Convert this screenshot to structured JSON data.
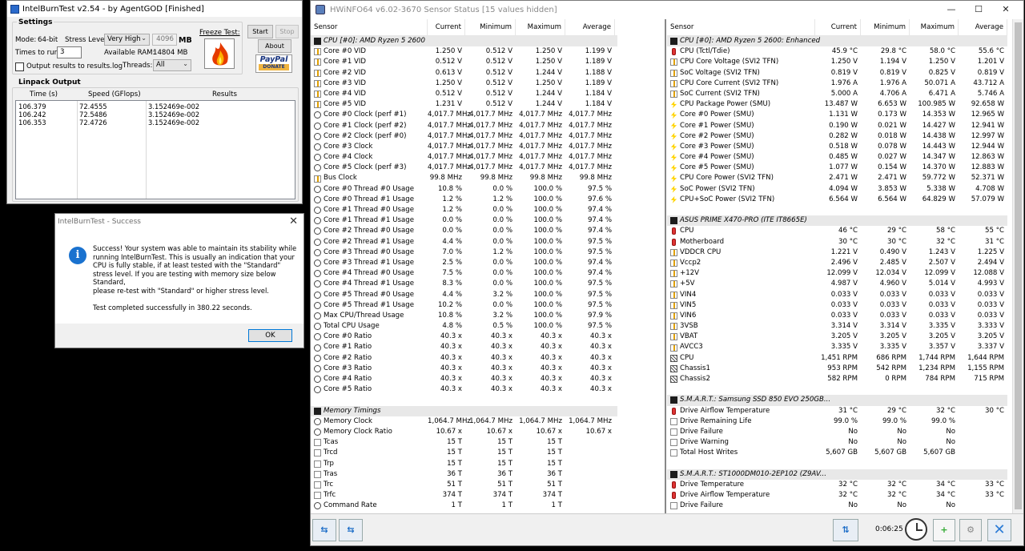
{
  "ibt": {
    "title": "IntelBurnTest v2.54 - by AgentGOD [Finished]",
    "settings_legend": "Settings",
    "mode_label": "Mode:",
    "mode_value": "64-bit",
    "stress_label": "Stress Level:",
    "stress_value": "Very High",
    "stress_mb": "4096",
    "mb_label": "MB",
    "times_label": "Times to run:",
    "times_value": "3",
    "ram_label": "Available RAM:",
    "ram_value": "14804 MB",
    "output_label": "Output results to results.log",
    "threads_label": "Threads:",
    "threads_value": "All",
    "freeze_label": "Freeze Test:",
    "start_label": "Start",
    "stop_label": "Stop",
    "about_label": "About",
    "paypal_label": "PayPal",
    "donate_label": "DONATE",
    "linpack_legend": "Linpack Output",
    "columns": [
      "Time (s)",
      "Speed (GFlops)",
      "Results"
    ],
    "rows": [
      [
        "106.379",
        "72.4555",
        "3.152469e-002"
      ],
      [
        "106.242",
        "72.5486",
        "3.152469e-002"
      ],
      [
        "106.353",
        "72.4726",
        "3.152469e-002"
      ]
    ]
  },
  "msg": {
    "title": "IntelBurnTest - Success",
    "text": "Success! Your system was able to maintain its stability while running IntelBurnTest. This is usually an indication that your CPU is fully stable, if at least tested with the \"Standard\" stress level. If you are testing with memory size below Standard,\nplease re-test with \"Standard\" or higher stress level.\n\nTest completed successfully in 380.22 seconds.",
    "ok": "OK"
  },
  "hw": {
    "title": "HWiNFO64 v6.02-3670 Sensor Status [15 values hidden]",
    "minimize": "—",
    "maximize": "☐",
    "close": "✕",
    "columns": [
      "Sensor",
      "Current",
      "Minimum",
      "Maximum",
      "Average"
    ],
    "timer": "0:06:25",
    "left": [
      {
        "g": "CPU [#0]: AMD Ryzen 5 2600"
      },
      {
        "n": "Core #0 VID",
        "i": "volt",
        "c": "1.250 V",
        "mn": "0.512 V",
        "mx": "1.250 V",
        "a": "1.199 V"
      },
      {
        "n": "Core #1 VID",
        "i": "volt",
        "c": "0.512 V",
        "mn": "0.512 V",
        "mx": "1.250 V",
        "a": "1.189 V"
      },
      {
        "n": "Core #2 VID",
        "i": "volt",
        "c": "0.613 V",
        "mn": "0.512 V",
        "mx": "1.244 V",
        "a": "1.188 V"
      },
      {
        "n": "Core #3 VID",
        "i": "volt",
        "c": "1.250 V",
        "mn": "0.512 V",
        "mx": "1.250 V",
        "a": "1.189 V"
      },
      {
        "n": "Core #4 VID",
        "i": "volt",
        "c": "0.512 V",
        "mn": "0.512 V",
        "mx": "1.244 V",
        "a": "1.184 V"
      },
      {
        "n": "Core #5 VID",
        "i": "volt",
        "c": "1.231 V",
        "mn": "0.512 V",
        "mx": "1.244 V",
        "a": "1.184 V"
      },
      {
        "n": "Core #0 Clock (perf #1)",
        "i": "clock",
        "c": "4,017.7 MHz",
        "mn": "4,017.7 MHz",
        "mx": "4,017.7 MHz",
        "a": "4,017.7 MHz"
      },
      {
        "n": "Core #1 Clock (perf #2)",
        "i": "clock",
        "c": "4,017.7 MHz",
        "mn": "4,017.7 MHz",
        "mx": "4,017.7 MHz",
        "a": "4,017.7 MHz"
      },
      {
        "n": "Core #2 Clock (perf #0)",
        "i": "clock",
        "c": "4,017.7 MHz",
        "mn": "4,017.7 MHz",
        "mx": "4,017.7 MHz",
        "a": "4,017.7 MHz"
      },
      {
        "n": "Core #3 Clock",
        "i": "clock",
        "c": "4,017.7 MHz",
        "mn": "4,017.7 MHz",
        "mx": "4,017.7 MHz",
        "a": "4,017.7 MHz"
      },
      {
        "n": "Core #4 Clock",
        "i": "clock",
        "c": "4,017.7 MHz",
        "mn": "4,017.7 MHz",
        "mx": "4,017.7 MHz",
        "a": "4,017.7 MHz"
      },
      {
        "n": "Core #5 Clock (perf #3)",
        "i": "clock",
        "c": "4,017.7 MHz",
        "mn": "4,017.7 MHz",
        "mx": "4,017.7 MHz",
        "a": "4,017.7 MHz"
      },
      {
        "n": "Bus Clock",
        "i": "volt",
        "c": "99.8 MHz",
        "mn": "99.8 MHz",
        "mx": "99.8 MHz",
        "a": "99.8 MHz"
      },
      {
        "n": "Core #0 Thread #0 Usage",
        "i": "clock",
        "c": "10.8 %",
        "mn": "0.0 %",
        "mx": "100.0 %",
        "a": "97.5 %"
      },
      {
        "n": "Core #0 Thread #1 Usage",
        "i": "clock",
        "c": "1.2 %",
        "mn": "1.2 %",
        "mx": "100.0 %",
        "a": "97.6 %"
      },
      {
        "n": "Core #1 Thread #0 Usage",
        "i": "clock",
        "c": "1.2 %",
        "mn": "0.0 %",
        "mx": "100.0 %",
        "a": "97.4 %"
      },
      {
        "n": "Core #1 Thread #1 Usage",
        "i": "clock",
        "c": "0.0 %",
        "mn": "0.0 %",
        "mx": "100.0 %",
        "a": "97.4 %"
      },
      {
        "n": "Core #2 Thread #0 Usage",
        "i": "clock",
        "c": "0.0 %",
        "mn": "0.0 %",
        "mx": "100.0 %",
        "a": "97.4 %"
      },
      {
        "n": "Core #2 Thread #1 Usage",
        "i": "clock",
        "c": "4.4 %",
        "mn": "0.0 %",
        "mx": "100.0 %",
        "a": "97.5 %"
      },
      {
        "n": "Core #3 Thread #0 Usage",
        "i": "clock",
        "c": "7.0 %",
        "mn": "1.2 %",
        "mx": "100.0 %",
        "a": "97.5 %"
      },
      {
        "n": "Core #3 Thread #1 Usage",
        "i": "clock",
        "c": "2.5 %",
        "mn": "0.0 %",
        "mx": "100.0 %",
        "a": "97.4 %"
      },
      {
        "n": "Core #4 Thread #0 Usage",
        "i": "clock",
        "c": "7.5 %",
        "mn": "0.0 %",
        "mx": "100.0 %",
        "a": "97.4 %"
      },
      {
        "n": "Core #4 Thread #1 Usage",
        "i": "clock",
        "c": "8.3 %",
        "mn": "0.0 %",
        "mx": "100.0 %",
        "a": "97.5 %"
      },
      {
        "n": "Core #5 Thread #0 Usage",
        "i": "clock",
        "c": "4.4 %",
        "mn": "3.2 %",
        "mx": "100.0 %",
        "a": "97.5 %"
      },
      {
        "n": "Core #5 Thread #1 Usage",
        "i": "clock",
        "c": "10.2 %",
        "mn": "0.0 %",
        "mx": "100.0 %",
        "a": "97.5 %"
      },
      {
        "n": "Max CPU/Thread Usage",
        "i": "clock",
        "c": "10.8 %",
        "mn": "3.2 %",
        "mx": "100.0 %",
        "a": "97.9 %"
      },
      {
        "n": "Total CPU Usage",
        "i": "clock",
        "c": "4.8 %",
        "mn": "0.5 %",
        "mx": "100.0 %",
        "a": "97.5 %"
      },
      {
        "n": "Core #0 Ratio",
        "i": "clock",
        "c": "40.3 x",
        "mn": "40.3 x",
        "mx": "40.3 x",
        "a": "40.3 x"
      },
      {
        "n": "Core #1 Ratio",
        "i": "clock",
        "c": "40.3 x",
        "mn": "40.3 x",
        "mx": "40.3 x",
        "a": "40.3 x"
      },
      {
        "n": "Core #2 Ratio",
        "i": "clock",
        "c": "40.3 x",
        "mn": "40.3 x",
        "mx": "40.3 x",
        "a": "40.3 x"
      },
      {
        "n": "Core #3 Ratio",
        "i": "clock",
        "c": "40.3 x",
        "mn": "40.3 x",
        "mx": "40.3 x",
        "a": "40.3 x"
      },
      {
        "n": "Core #4 Ratio",
        "i": "clock",
        "c": "40.3 x",
        "mn": "40.3 x",
        "mx": "40.3 x",
        "a": "40.3 x"
      },
      {
        "n": "Core #5 Ratio",
        "i": "clock",
        "c": "40.3 x",
        "mn": "40.3 x",
        "mx": "40.3 x",
        "a": "40.3 x"
      },
      {
        "gap": true
      },
      {
        "g": "Memory Timings"
      },
      {
        "n": "Memory Clock",
        "i": "clock",
        "c": "1,064.7 MHz",
        "mn": "1,064.7 MHz",
        "mx": "1,064.7 MHz",
        "a": "1,064.7 MHz"
      },
      {
        "n": "Memory Clock Ratio",
        "i": "clock",
        "c": "10.67 x",
        "mn": "10.67 x",
        "mx": "10.67 x",
        "a": "10.67 x"
      },
      {
        "n": "Tcas",
        "i": "box",
        "c": "15 T",
        "mn": "15 T",
        "mx": "15 T",
        "a": ""
      },
      {
        "n": "Trcd",
        "i": "box",
        "c": "15 T",
        "mn": "15 T",
        "mx": "15 T",
        "a": ""
      },
      {
        "n": "Trp",
        "i": "box",
        "c": "15 T",
        "mn": "15 T",
        "mx": "15 T",
        "a": ""
      },
      {
        "n": "Tras",
        "i": "box",
        "c": "36 T",
        "mn": "36 T",
        "mx": "36 T",
        "a": ""
      },
      {
        "n": "Trc",
        "i": "box",
        "c": "51 T",
        "mn": "51 T",
        "mx": "51 T",
        "a": ""
      },
      {
        "n": "Trfc",
        "i": "box",
        "c": "374 T",
        "mn": "374 T",
        "mx": "374 T",
        "a": ""
      },
      {
        "n": "Command Rate",
        "i": "clock",
        "c": "1 T",
        "mn": "1 T",
        "mx": "1 T",
        "a": ""
      }
    ],
    "right": [
      {
        "g": "CPU [#0]: AMD Ryzen 5 2600: Enhanced"
      },
      {
        "n": "CPU (Tctl/Tdie)",
        "i": "temp",
        "c": "45.9 °C",
        "mn": "29.8 °C",
        "mx": "58.0 °C",
        "a": "55.6 °C"
      },
      {
        "n": "CPU Core Voltage (SVI2 TFN)",
        "i": "volt",
        "c": "1.250 V",
        "mn": "1.194 V",
        "mx": "1.250 V",
        "a": "1.201 V"
      },
      {
        "n": "SoC Voltage (SVI2 TFN)",
        "i": "volt",
        "c": "0.819 V",
        "mn": "0.819 V",
        "mx": "0.825 V",
        "a": "0.819 V"
      },
      {
        "n": "CPU Core Current (SVI2 TFN)",
        "i": "volt",
        "c": "1.976 A",
        "mn": "1.976 A",
        "mx": "50.071 A",
        "a": "43.712 A"
      },
      {
        "n": "SoC Current (SVI2 TFN)",
        "i": "volt",
        "c": "5.000 A",
        "mn": "4.706 A",
        "mx": "6.471 A",
        "a": "5.746 A"
      },
      {
        "n": "CPU Package Power (SMU)",
        "i": "bolt",
        "c": "13.487 W",
        "mn": "6.653 W",
        "mx": "100.985 W",
        "a": "92.658 W"
      },
      {
        "n": "Core #0 Power (SMU)",
        "i": "bolt",
        "c": "1.131 W",
        "mn": "0.173 W",
        "mx": "14.353 W",
        "a": "12.965 W"
      },
      {
        "n": "Core #1 Power (SMU)",
        "i": "bolt",
        "c": "0.190 W",
        "mn": "0.021 W",
        "mx": "14.427 W",
        "a": "12.941 W"
      },
      {
        "n": "Core #2 Power (SMU)",
        "i": "bolt",
        "c": "0.282 W",
        "mn": "0.018 W",
        "mx": "14.438 W",
        "a": "12.997 W"
      },
      {
        "n": "Core #3 Power (SMU)",
        "i": "bolt",
        "c": "0.518 W",
        "mn": "0.078 W",
        "mx": "14.443 W",
        "a": "12.944 W"
      },
      {
        "n": "Core #4 Power (SMU)",
        "i": "bolt",
        "c": "0.485 W",
        "mn": "0.027 W",
        "mx": "14.347 W",
        "a": "12.863 W"
      },
      {
        "n": "Core #5 Power (SMU)",
        "i": "bolt",
        "c": "1.077 W",
        "mn": "0.154 W",
        "mx": "14.370 W",
        "a": "12.883 W"
      },
      {
        "n": "CPU Core Power (SVI2 TFN)",
        "i": "bolt",
        "c": "2.471 W",
        "mn": "2.471 W",
        "mx": "59.772 W",
        "a": "52.371 W"
      },
      {
        "n": "SoC Power (SVI2 TFN)",
        "i": "bolt",
        "c": "4.094 W",
        "mn": "3.853 W",
        "mx": "5.338 W",
        "a": "4.708 W"
      },
      {
        "n": "CPU+SoC Power (SVI2 TFN)",
        "i": "bolt",
        "c": "6.564 W",
        "mn": "6.564 W",
        "mx": "64.829 W",
        "a": "57.079 W"
      },
      {
        "gap": true
      },
      {
        "g": "ASUS PRIME X470-PRO (ITE IT8665E)"
      },
      {
        "n": "CPU",
        "i": "temp",
        "c": "46 °C",
        "mn": "29 °C",
        "mx": "58 °C",
        "a": "55 °C"
      },
      {
        "n": "Motherboard",
        "i": "temp",
        "c": "30 °C",
        "mn": "30 °C",
        "mx": "32 °C",
        "a": "31 °C"
      },
      {
        "n": "VDDCR CPU",
        "i": "volt",
        "c": "1.221 V",
        "mn": "0.490 V",
        "mx": "1.243 V",
        "a": "1.225 V"
      },
      {
        "n": "Vccp2",
        "i": "volt",
        "c": "2.496 V",
        "mn": "2.485 V",
        "mx": "2.507 V",
        "a": "2.494 V"
      },
      {
        "n": "+12V",
        "i": "volt",
        "c": "12.099 V",
        "mn": "12.034 V",
        "mx": "12.099 V",
        "a": "12.088 V"
      },
      {
        "n": "+5V",
        "i": "volt",
        "c": "4.987 V",
        "mn": "4.960 V",
        "mx": "5.014 V",
        "a": "4.993 V"
      },
      {
        "n": "VIN4",
        "i": "volt",
        "c": "0.033 V",
        "mn": "0.033 V",
        "mx": "0.033 V",
        "a": "0.033 V"
      },
      {
        "n": "VIN5",
        "i": "volt",
        "c": "0.033 V",
        "mn": "0.033 V",
        "mx": "0.033 V",
        "a": "0.033 V"
      },
      {
        "n": "VIN6",
        "i": "volt",
        "c": "0.033 V",
        "mn": "0.033 V",
        "mx": "0.033 V",
        "a": "0.033 V"
      },
      {
        "n": "3VSB",
        "i": "volt",
        "c": "3.314 V",
        "mn": "3.314 V",
        "mx": "3.335 V",
        "a": "3.333 V"
      },
      {
        "n": "VBAT",
        "i": "volt",
        "c": "3.205 V",
        "mn": "3.205 V",
        "mx": "3.205 V",
        "a": "3.205 V"
      },
      {
        "n": "AVCC3",
        "i": "volt",
        "c": "3.335 V",
        "mn": "3.335 V",
        "mx": "3.357 V",
        "a": "3.337 V"
      },
      {
        "n": "CPU",
        "i": "fan",
        "c": "1,451 RPM",
        "mn": "686 RPM",
        "mx": "1,744 RPM",
        "a": "1,644 RPM"
      },
      {
        "n": "Chassis1",
        "i": "fan",
        "c": "953 RPM",
        "mn": "542 RPM",
        "mx": "1,234 RPM",
        "a": "1,155 RPM"
      },
      {
        "n": "Chassis2",
        "i": "fan",
        "c": "582 RPM",
        "mn": "0 RPM",
        "mx": "784 RPM",
        "a": "715 RPM"
      },
      {
        "gap": true
      },
      {
        "g": "S.M.A.R.T.: Samsung SSD 850 EVO 250GB..."
      },
      {
        "n": "Drive Airflow Temperature",
        "i": "temp",
        "c": "31 °C",
        "mn": "29 °C",
        "mx": "32 °C",
        "a": "30 °C"
      },
      {
        "n": "Drive Remaining Life",
        "i": "box",
        "c": "99.0 %",
        "mn": "99.0 %",
        "mx": "99.0 %",
        "a": ""
      },
      {
        "n": "Drive Failure",
        "i": "box",
        "c": "No",
        "mn": "No",
        "mx": "No",
        "a": ""
      },
      {
        "n": "Drive Warning",
        "i": "box",
        "c": "No",
        "mn": "No",
        "mx": "No",
        "a": ""
      },
      {
        "n": "Total Host Writes",
        "i": "box",
        "c": "5,607 GB",
        "mn": "5,607 GB",
        "mx": "5,607 GB",
        "a": ""
      },
      {
        "gap": true
      },
      {
        "g": "S.M.A.R.T.: ST1000DM010-2EP102 (Z9AV..."
      },
      {
        "n": "Drive Temperature",
        "i": "temp",
        "c": "32 °C",
        "mn": "32 °C",
        "mx": "34 °C",
        "a": "33 °C"
      },
      {
        "n": "Drive Airflow Temperature",
        "i": "temp",
        "c": "32 °C",
        "mn": "32 °C",
        "mx": "34 °C",
        "a": "33 °C"
      },
      {
        "n": "Drive Failure",
        "i": "box",
        "c": "No",
        "mn": "No",
        "mx": "No",
        "a": ""
      }
    ]
  }
}
